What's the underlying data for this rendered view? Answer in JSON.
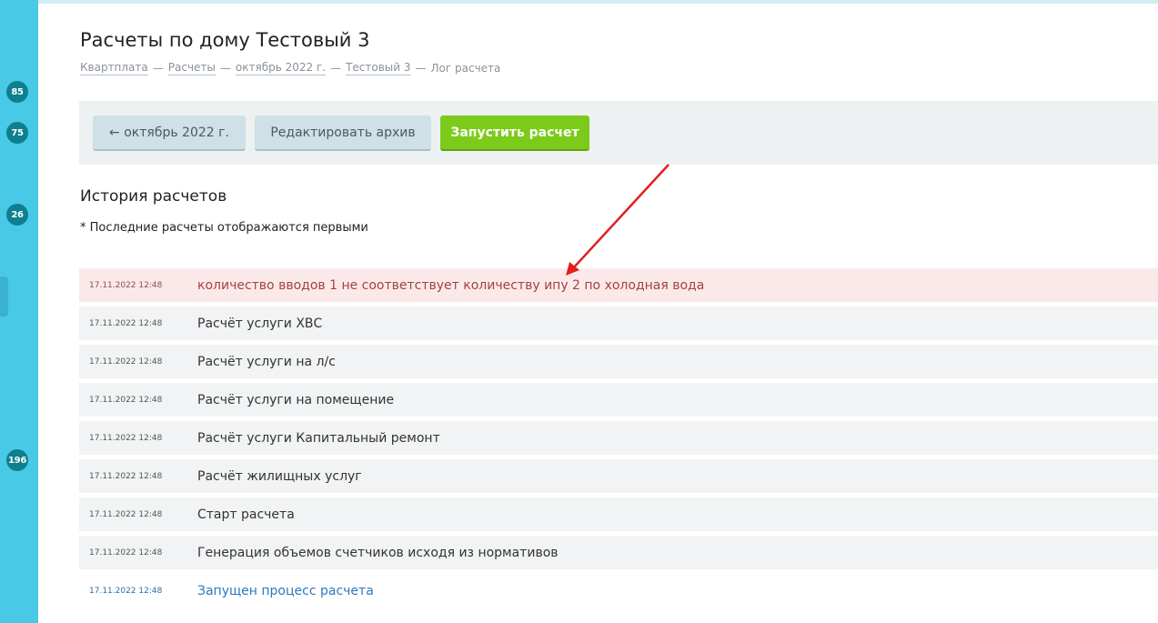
{
  "sidebar": {
    "badges": [
      "85",
      "75",
      "26",
      "196"
    ]
  },
  "header": {
    "title": "Расчеты по дому Тестовый 3",
    "breadcrumb": [
      "Квартплата",
      "Расчеты",
      "октябрь 2022 г.",
      "Тестовый 3"
    ],
    "breadcrumb_current": "Лог расчета",
    "separator": "—"
  },
  "toolbar": {
    "back_label": "← октябрь 2022 г.",
    "edit_archive_label": "Редактировать архив",
    "run_label": "Запустить расчет"
  },
  "history": {
    "title": "История расчетов",
    "note": "* Последние расчеты отображаются первыми",
    "rows": [
      {
        "date": "17.11.2022 12:48",
        "message": "количество вводов 1 не соответствует количеству ипу 2 по холодная вода",
        "status": "error"
      },
      {
        "date": "17.11.2022 12:48",
        "message": "Расчёт услуги ХВС",
        "status": "normal"
      },
      {
        "date": "17.11.2022 12:48",
        "message": "Расчёт услуги на л/с",
        "status": "normal"
      },
      {
        "date": "17.11.2022 12:48",
        "message": "Расчёт услуги на помещение",
        "status": "normal"
      },
      {
        "date": "17.11.2022 12:48",
        "message": "Расчёт услуги Капитальный ремонт",
        "status": "normal"
      },
      {
        "date": "17.11.2022 12:48",
        "message": "Расчёт жилищных услуг",
        "status": "normal"
      },
      {
        "date": "17.11.2022 12:48",
        "message": "Старт расчета",
        "status": "normal"
      },
      {
        "date": "17.11.2022 12:48",
        "message": "Генерация объемов счетчиков исходя из нормативов",
        "status": "normal"
      },
      {
        "date": "17.11.2022 12:48",
        "message": "Запущен процесс расчета",
        "status": "info"
      }
    ]
  },
  "colors": {
    "sidebar": "#48c9e6",
    "badge": "#0e7f90",
    "primary_button": "#7ccb1a",
    "error_row_bg": "#fbe9ea",
    "error_text": "#a3433f",
    "info_text": "#2a78c0",
    "annotation_arrow": "#e0201c"
  }
}
